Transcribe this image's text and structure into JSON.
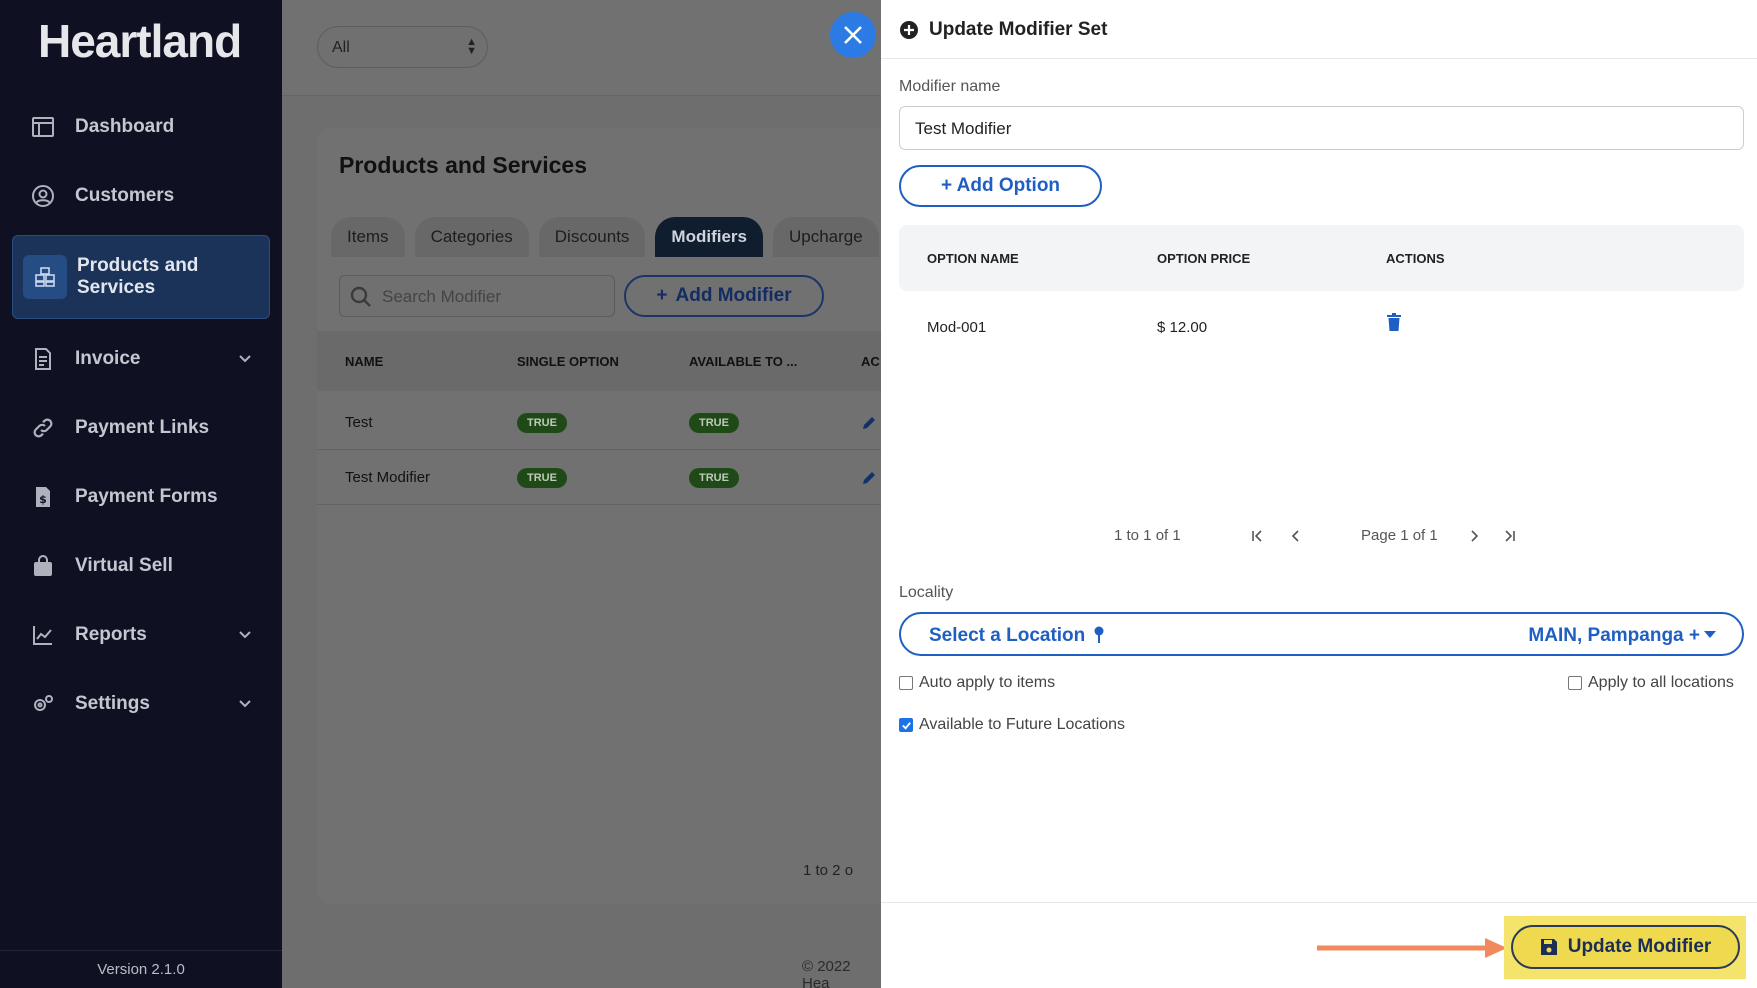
{
  "sidebar": {
    "logo": "Heartland",
    "items": [
      {
        "label": "Dashboard",
        "icon": "dashboard-icon"
      },
      {
        "label": "Customers",
        "icon": "user-circle-icon"
      },
      {
        "label": "Products and Services",
        "icon": "boxes-icon"
      },
      {
        "label": "Invoice",
        "icon": "file-icon"
      },
      {
        "label": "Payment Links",
        "icon": "link-icon"
      },
      {
        "label": "Payment Forms",
        "icon": "dollar-file-icon"
      },
      {
        "label": "Virtual Sell",
        "icon": "shopping-bag-icon"
      },
      {
        "label": "Reports",
        "icon": "chart-icon"
      },
      {
        "label": "Settings",
        "icon": "gears-icon"
      }
    ],
    "version": "Version 2.1.0"
  },
  "main": {
    "filter_value": "All",
    "title": "Products and Services",
    "tabs": [
      "Items",
      "Categories",
      "Discounts",
      "Modifiers",
      "Upcharge"
    ],
    "search_placeholder": "Search Modifier",
    "add_button": "Add Modifier",
    "table": {
      "headers": [
        "NAME",
        "SINGLE OPTION",
        "AVAILABLE TO ...",
        "AC"
      ],
      "rows": [
        {
          "name": "Test",
          "single": "TRUE",
          "available": "TRUE"
        },
        {
          "name": "Test Modifier",
          "single": "TRUE",
          "available": "TRUE"
        }
      ]
    },
    "pager": "1 to 2 o",
    "copyright": "© 2022 Hea"
  },
  "panel": {
    "title": "Update Modifier Set",
    "modifier_name_label": "Modifier name",
    "modifier_name_value": "Test Modifier",
    "add_option": "+ Add Option",
    "options_table": {
      "headers": [
        "OPTION NAME",
        "OPTION PRICE",
        "ACTIONS"
      ],
      "rows": [
        {
          "name": "Mod-001",
          "price": "$ 12.00"
        }
      ]
    },
    "pagination": {
      "count": "1 to 1 of 1",
      "page": "Page 1 of 1"
    },
    "locality_label": "Locality",
    "location_select": "Select a Location",
    "location_value": "MAIN, Pampanga +",
    "auto_apply": {
      "label": "Auto apply to items",
      "checked": false
    },
    "apply_all": {
      "label": "Apply to all locations",
      "checked": false
    },
    "future_locations": {
      "label": "Available to Future Locations",
      "checked": true
    },
    "update_button": "Update Modifier"
  },
  "colors": {
    "accent": "#1f5fc4",
    "close": "#2c7be5",
    "highlight": "#f5e46b",
    "arrow": "#f08a5d",
    "sidebar": "#0f1122"
  }
}
